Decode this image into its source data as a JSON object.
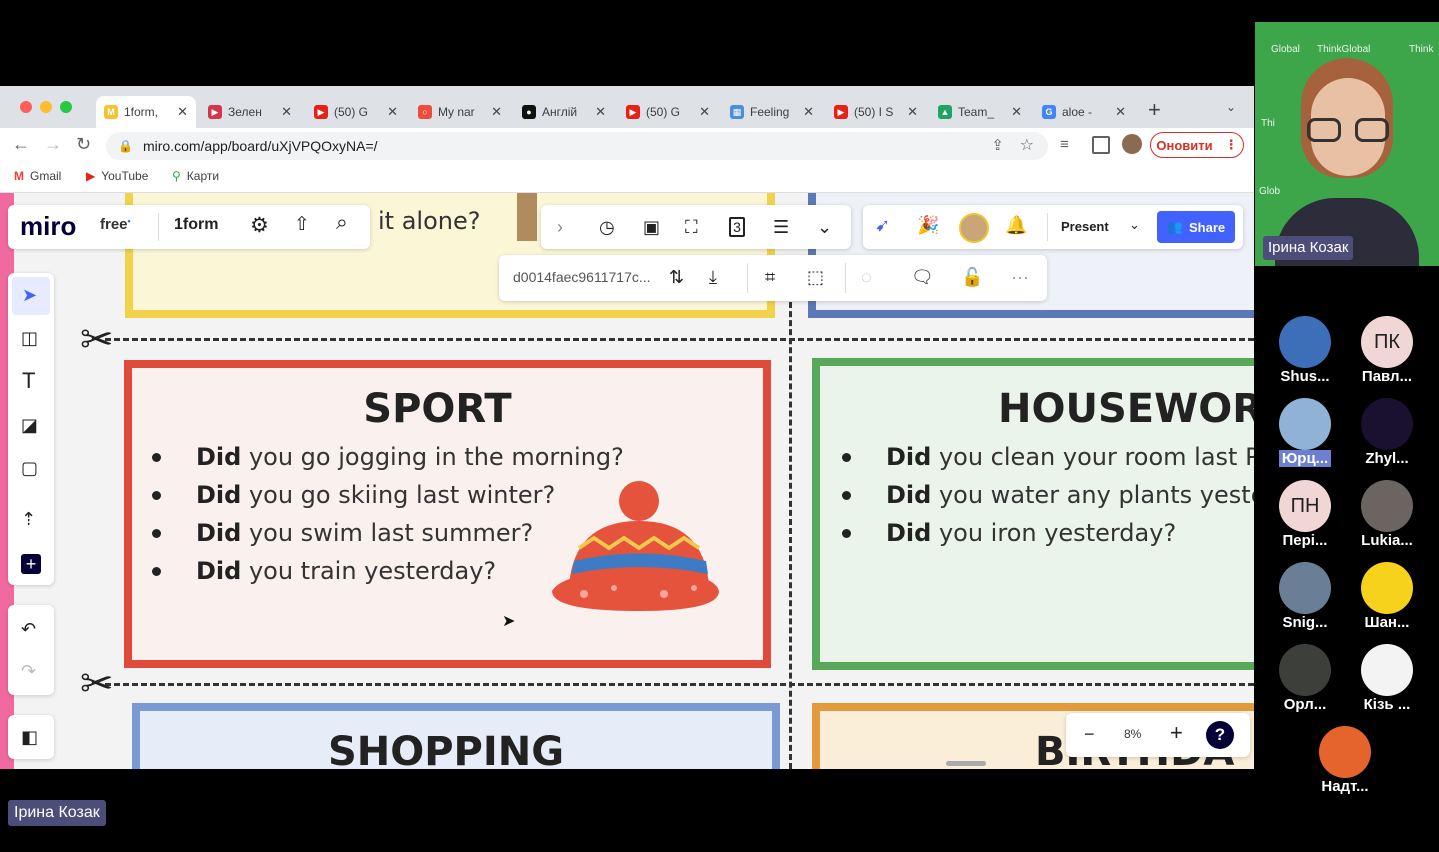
{
  "browser": {
    "tabs": [
      {
        "title": "1form, ",
        "color": "#f4c430",
        "glyph": "M"
      },
      {
        "title": "Зелен",
        "color": "#d1364c",
        "glyph": "▶"
      },
      {
        "title": "(50) G",
        "color": "#e62117",
        "glyph": "▶"
      },
      {
        "title": "My nar",
        "color": "#ef4b3b",
        "glyph": "○"
      },
      {
        "title": "Англій",
        "color": "#111111",
        "glyph": "●"
      },
      {
        "title": "(50) G",
        "color": "#e62117",
        "glyph": "▶"
      },
      {
        "title": "Feeling",
        "color": "#4a90d9",
        "glyph": "▦"
      },
      {
        "title": "(50) I S",
        "color": "#e62117",
        "glyph": "▶"
      },
      {
        "title": "Team_",
        "color": "#1fa463",
        "glyph": "▲"
      },
      {
        "title": "aloe -",
        "color": "#4285f4",
        "glyph": "G"
      }
    ],
    "new_tab": "+",
    "url": "miro.com/app/board/uXjVPQOxyNA=/",
    "update_button": "Оновити",
    "bookmarks": [
      {
        "label": "Gmail",
        "color": "#ea4335",
        "glyph": "M"
      },
      {
        "label": "YouTube",
        "color": "#e62117",
        "glyph": "▶"
      },
      {
        "label": "Карти",
        "color": "#34a853",
        "glyph": "⚲"
      }
    ]
  },
  "miro": {
    "logo": "miro",
    "plan_badge": "free",
    "board_name": "1form",
    "present_label": "Present",
    "share_label": "Share",
    "selection_id": "d0014faec9611717c...",
    "zoom": "8%",
    "help": "?"
  },
  "board": {
    "top_fragment": "it alone?",
    "sport": {
      "title": "SPORT",
      "questions": [
        {
          "bold": "Did",
          "rest": " you go jogging in the morning?"
        },
        {
          "bold": "Did",
          "rest": " you go skiing last winter?"
        },
        {
          "bold": "Did",
          "rest": " you swim last summer?"
        },
        {
          "bold": "Did",
          "rest": " you train yesterday?"
        }
      ]
    },
    "housework": {
      "title": "HOUSEWORI",
      "questions": [
        {
          "bold": "Did",
          "rest": " you clean your room last P"
        },
        {
          "bold": "Did",
          "rest": " you water any plants yeste"
        },
        {
          "bold": "Did",
          "rest": " you iron yesterday?"
        }
      ]
    },
    "shopping_title": "SHOPPING",
    "birthday_title": "BIRTHDA"
  },
  "video": {
    "speaker_name": "Ірина Козак",
    "presenter_label": "Ірина Козак",
    "background_text": [
      "Global",
      "ThinkGlobal",
      "Think",
      "Thi",
      "Glob"
    ],
    "participants": [
      {
        "name": "Shus...",
        "initials": "",
        "bg": "#3d6fb8"
      },
      {
        "name": "Павл...",
        "initials": "ПК",
        "bg": "#f1d6d6"
      },
      {
        "name": "Юрц...",
        "initials": "",
        "bg": "#8fb2d6"
      },
      {
        "name": "Zhyl...",
        "initials": "",
        "bg": "#1a1030"
      },
      {
        "name": "Пері...",
        "initials": "ПН",
        "bg": "#f1d6d6"
      },
      {
        "name": "Lukia...",
        "initials": "",
        "bg": "#6b6460"
      },
      {
        "name": "Snig...",
        "initials": "",
        "bg": "#6a7f96"
      },
      {
        "name": "Шан...",
        "initials": "",
        "bg": "#f7d21c"
      },
      {
        "name": "Орл...",
        "initials": "",
        "bg": "#3c3f3a"
      },
      {
        "name": "Кізь ...",
        "initials": "",
        "bg": "#f3f3f3"
      },
      {
        "name": "Надт...",
        "initials": "",
        "bg": "#e5642c"
      }
    ]
  }
}
